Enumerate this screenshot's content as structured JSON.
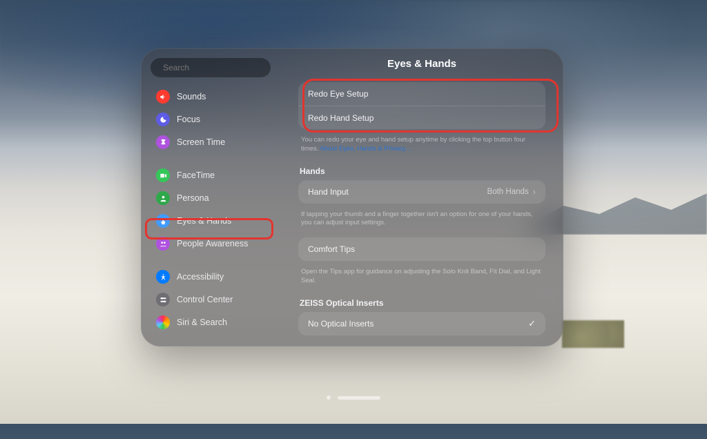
{
  "search": {
    "placeholder": "Search"
  },
  "sidebar": {
    "groups": [
      [
        {
          "key": "sounds",
          "label": "Sounds",
          "icon": "speaker-icon",
          "color": "bg-red"
        },
        {
          "key": "focus",
          "label": "Focus",
          "icon": "moon-icon",
          "color": "bg-indigo"
        },
        {
          "key": "screen-time",
          "label": "Screen Time",
          "icon": "hourglass-icon",
          "color": "bg-purple"
        }
      ],
      [
        {
          "key": "facetime",
          "label": "FaceTime",
          "icon": "video-icon",
          "color": "bg-green"
        },
        {
          "key": "persona",
          "label": "Persona",
          "icon": "person-icon",
          "color": "bg-greenD"
        },
        {
          "key": "eyes-hands",
          "label": "Eyes & Hands",
          "icon": "tap-icon",
          "color": "bg-blueL",
          "selected": true
        },
        {
          "key": "people-awareness",
          "label": "People Awareness",
          "icon": "people-icon",
          "color": "bg-purple"
        }
      ],
      [
        {
          "key": "accessibility",
          "label": "Accessibility",
          "icon": "accessibility-icon",
          "color": "bg-blue"
        },
        {
          "key": "control-center",
          "label": "Control Center",
          "icon": "switches-icon",
          "color": "bg-grey"
        },
        {
          "key": "siri-search",
          "label": "Siri & Search",
          "icon": "siri-icon",
          "color": "bg-blueD"
        }
      ]
    ]
  },
  "main": {
    "title": "Eyes & Hands",
    "redo": {
      "eye": "Redo Eye Setup",
      "hand": "Redo Hand Setup",
      "caption_a": "You can redo your eye and hand setup anytime by clicking the top button four times. ",
      "caption_link": "About Eyes, Hands & Privacy…"
    },
    "hands": {
      "header": "Hands",
      "hand_input_label": "Hand Input",
      "hand_input_value": "Both Hands",
      "caption": "If tapping your thumb and a finger together isn't an option for one of your hands, you can adjust input settings."
    },
    "comfort": {
      "row": "Comfort Tips",
      "caption": "Open the Tips app for guidance on adjusting the Solo Knit Band, Fit Dial, and Light Seal."
    },
    "zeiss": {
      "header": "ZEISS Optical Inserts",
      "row": "No Optical Inserts",
      "checked": true
    }
  }
}
